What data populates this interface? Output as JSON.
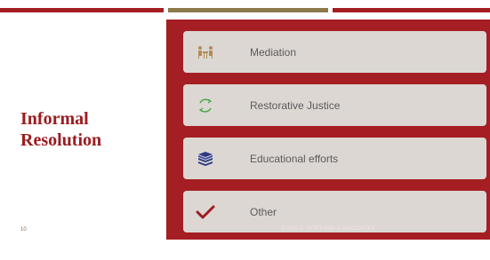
{
  "slide": {
    "title": "Informal Resolution",
    "page_number": "10",
    "copyright": "© 2020 D. STAFFORD & ASSOCIATES"
  },
  "items": [
    {
      "label": "Mediation",
      "icon": "meeting-people-icon"
    },
    {
      "label": "Restorative Justice",
      "icon": "cycle-arrows-icon"
    },
    {
      "label": "Educational efforts",
      "icon": "stacked-books-icon"
    },
    {
      "label": "Other",
      "icon": "checkmark-icon"
    }
  ],
  "colors": {
    "accent_red": "#a51e23",
    "accent_gold": "#8a7a4c",
    "card_bg": "#dcd7d3",
    "title_red": "#9b1c20",
    "icon_gold": "#b38b55",
    "icon_green": "#4aa84a",
    "icon_navy": "#2c3a84",
    "icon_red": "#9b1c20"
  }
}
